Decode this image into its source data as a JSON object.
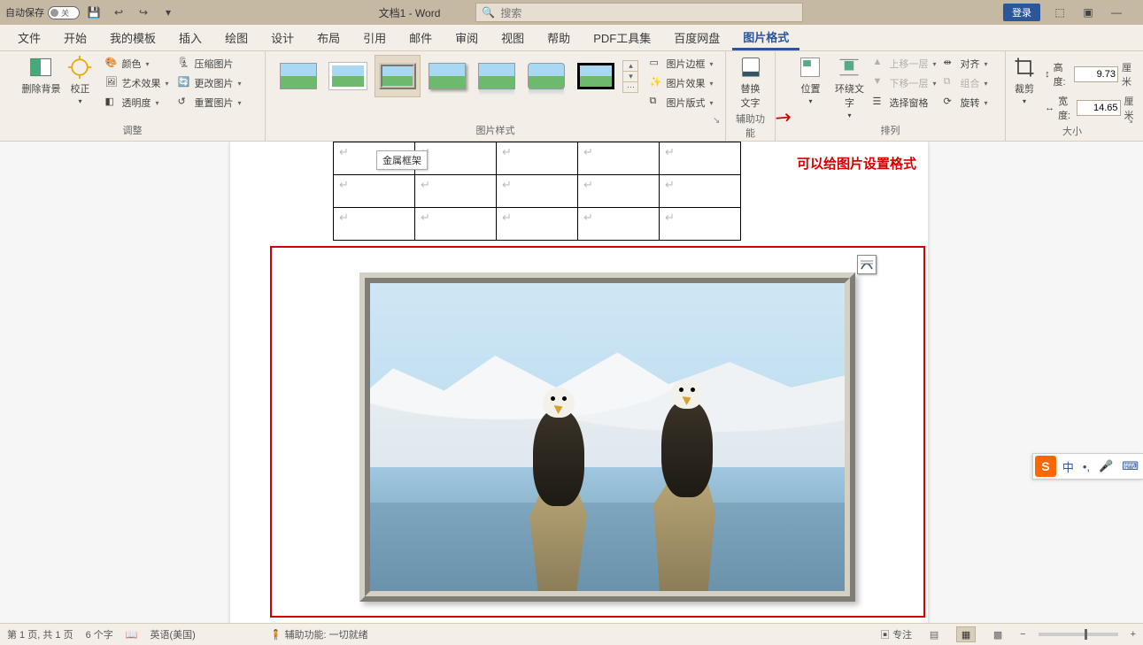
{
  "titlebar": {
    "autosave_label": "自动保存",
    "autosave_state": "关",
    "doc_title": "文档1  -  Word",
    "search_placeholder": "搜索",
    "login": "登录"
  },
  "tabs": [
    "文件",
    "开始",
    "我的模板",
    "插入",
    "绘图",
    "设计",
    "布局",
    "引用",
    "邮件",
    "审阅",
    "视图",
    "帮助",
    "PDF工具集",
    "百度网盘",
    "图片格式"
  ],
  "active_tab": "图片格式",
  "ribbon": {
    "adjust": {
      "label": "调整",
      "remove_bg": "删除背景",
      "corrections": "校正",
      "color": "颜色",
      "artistic": "艺术效果",
      "transparency": "透明度",
      "compress": "压缩图片",
      "change": "更改图片",
      "reset": "重置图片"
    },
    "styles": {
      "label": "图片样式",
      "tooltip": "金属框架",
      "border": "图片边框",
      "effects": "图片效果",
      "layout": "图片版式"
    },
    "accessibility": {
      "label": "辅助功能",
      "alt_text": "替换\n文字"
    },
    "arrange": {
      "label": "排列",
      "position": "位置",
      "wrap": "环绕文\n字",
      "forward": "上移一层",
      "backward": "下移一层",
      "selection": "选择窗格",
      "align": "对齐",
      "group": "组合",
      "rotate": "旋转"
    },
    "size": {
      "label": "大小",
      "crop": "裁剪",
      "height_label": "高度:",
      "height_value": "9.73",
      "width_label": "宽度:",
      "width_value": "14.65",
      "unit": "厘米"
    }
  },
  "annotation": "可以给图片设置格式",
  "status": {
    "page": "第 1 页, 共 1 页",
    "words": "6 个字",
    "lang": "英语(美国)",
    "accessibility": "辅助功能: 一切就绪",
    "focus": "专注",
    "zoom": "100%"
  },
  "ime": {
    "brand": "S",
    "items": [
      "中",
      "•,",
      "🎤",
      "⌨"
    ]
  }
}
